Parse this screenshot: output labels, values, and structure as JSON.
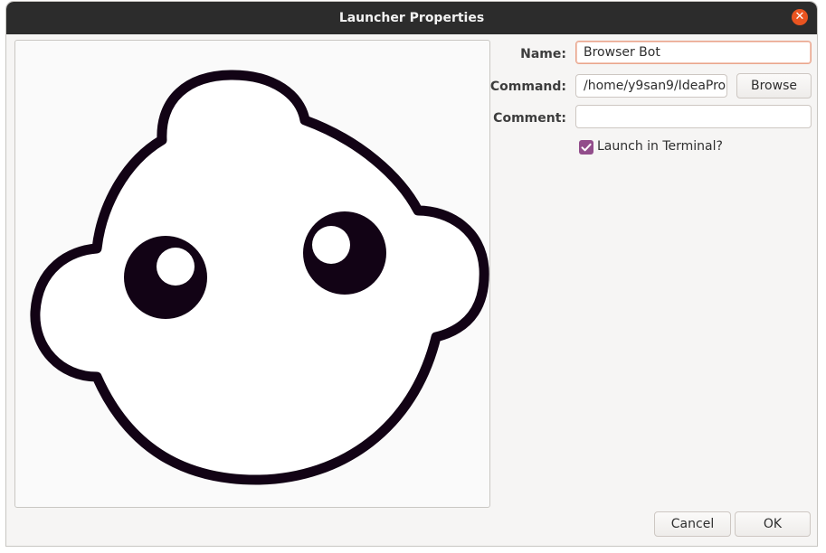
{
  "window": {
    "title": "Launcher Properties"
  },
  "icon": {
    "name": "browser-bot-face-icon"
  },
  "form": {
    "name_label": "Name:",
    "name_value": "Browser Bot",
    "command_label": "Command:",
    "command_value": "/home/y9san9/IdeaPro",
    "browse_label": "Browse",
    "comment_label": "Comment:",
    "comment_value": "",
    "terminal_label": "Launch in Terminal?",
    "terminal_checked": true
  },
  "actions": {
    "cancel_label": "Cancel",
    "ok_label": "OK"
  },
  "colors": {
    "titlebar": "#2c2c2c",
    "close": "#e95420",
    "checkbox": "#924d8b",
    "focus_border": "#e9a58c",
    "icon_outline": "#120315"
  }
}
